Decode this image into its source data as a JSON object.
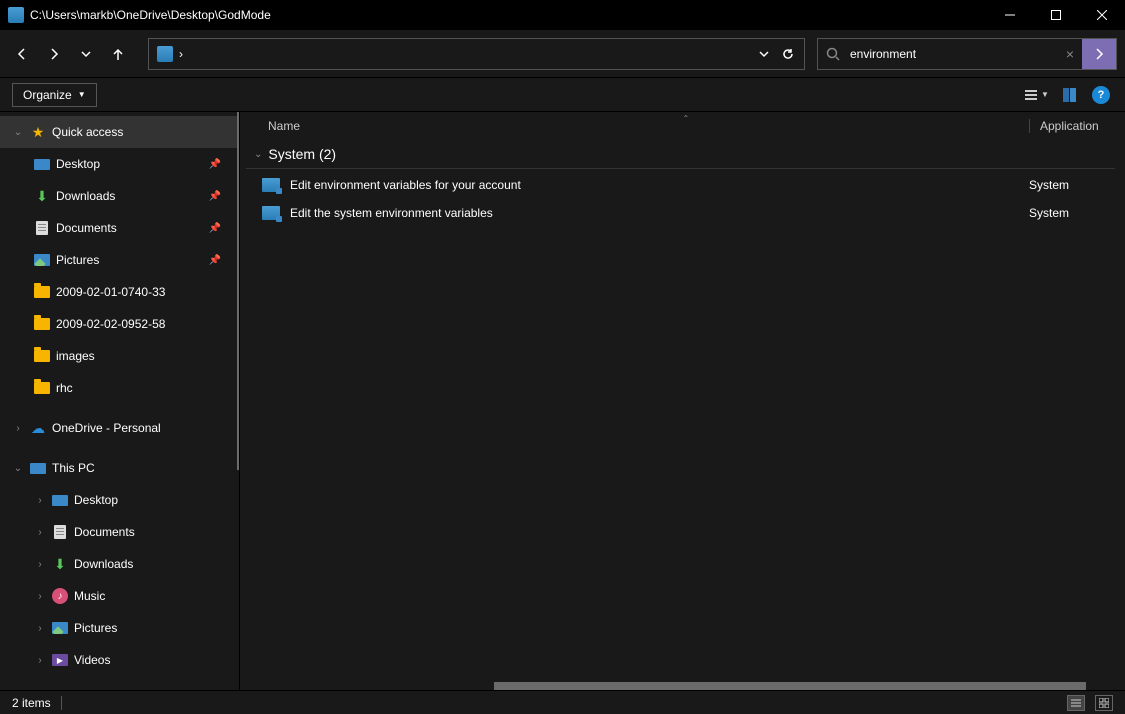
{
  "window": {
    "title": "C:\\Users\\markb\\OneDrive\\Desktop\\GodMode"
  },
  "address": {
    "crumb": "›"
  },
  "search": {
    "value": "environment"
  },
  "toolbar": {
    "organize": "Organize"
  },
  "columns": {
    "name": "Name",
    "application": "Application"
  },
  "group": {
    "label": "System (2)"
  },
  "results": [
    {
      "name": "Edit environment variables for your account",
      "app": "System"
    },
    {
      "name": "Edit the system environment variables",
      "app": "System"
    }
  ],
  "sidebar": {
    "quick_access": "Quick access",
    "qa": [
      {
        "label": "Desktop",
        "icon": "desktop",
        "pin": true
      },
      {
        "label": "Downloads",
        "icon": "download",
        "pin": true
      },
      {
        "label": "Documents",
        "icon": "doc",
        "pin": true
      },
      {
        "label": "Pictures",
        "icon": "pic",
        "pin": true
      },
      {
        "label": "2009-02-01-0740-33",
        "icon": "folder",
        "pin": false
      },
      {
        "label": "2009-02-02-0952-58",
        "icon": "folder",
        "pin": false
      },
      {
        "label": "images",
        "icon": "folder",
        "pin": false
      },
      {
        "label": "rhc",
        "icon": "folder",
        "pin": false
      }
    ],
    "onedrive": "OneDrive - Personal",
    "this_pc": "This PC",
    "pc": [
      {
        "label": "Desktop",
        "icon": "desktop"
      },
      {
        "label": "Documents",
        "icon": "doc"
      },
      {
        "label": "Downloads",
        "icon": "download"
      },
      {
        "label": "Music",
        "icon": "music"
      },
      {
        "label": "Pictures",
        "icon": "pic"
      },
      {
        "label": "Videos",
        "icon": "video"
      }
    ]
  },
  "status": {
    "items": "2 items"
  }
}
